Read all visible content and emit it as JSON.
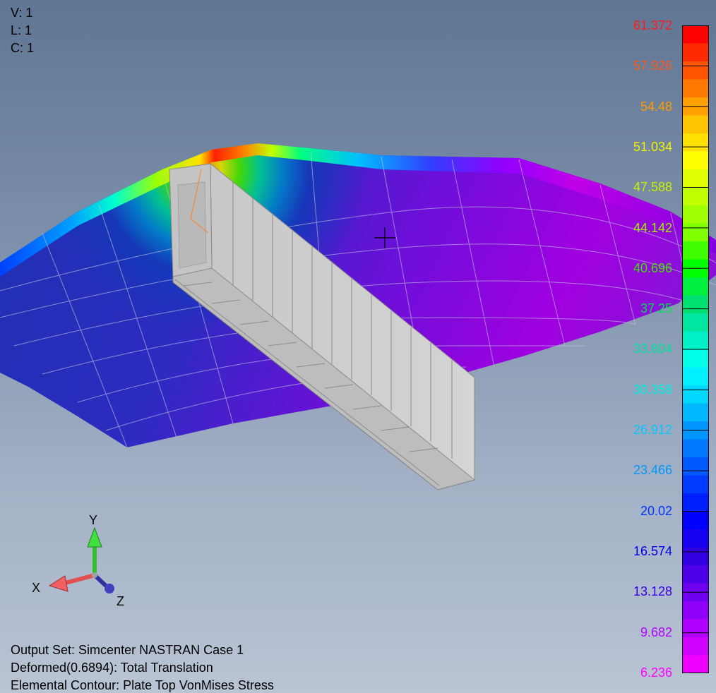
{
  "view_info": {
    "v": "V: 1",
    "l": "L: 1",
    "c": "C: 1"
  },
  "legend": {
    "labels": [
      "61.372",
      "57.926",
      "54.48",
      "51.034",
      "47.588",
      "44.142",
      "40.696",
      "37.25",
      "33.804",
      "30.358",
      "26.912",
      "23.466",
      "20.02",
      "16.574",
      "13.128",
      "9.682",
      "6.236"
    ],
    "label_colors": [
      "#ff1a1a",
      "#ff5a1a",
      "#ff9a00",
      "#f0f000",
      "#c8f000",
      "#a0f000",
      "#40e000",
      "#00e050",
      "#00e0a0",
      "#00f0e0",
      "#00c8ff",
      "#0096ff",
      "#0032ff",
      "#0000e0",
      "#3a00e0",
      "#b400ff",
      "#ff00ff"
    ],
    "bands": [
      "#ff0000",
      "#ff2a00",
      "#ff5500",
      "#ff7a00",
      "#ff9f00",
      "#ffc400",
      "#ffe000",
      "#ffff00",
      "#e0ff00",
      "#c0ff00",
      "#a0ff00",
      "#80ff00",
      "#40ff00",
      "#00ff00",
      "#00f040",
      "#00e070",
      "#00e6a0",
      "#00f0c8",
      "#00ffe6",
      "#00f0ff",
      "#00d8ff",
      "#00b8ff",
      "#0096ff",
      "#0078ff",
      "#005aff",
      "#003cff",
      "#0020ff",
      "#0000ff",
      "#1800f0",
      "#3000e0",
      "#5000e8",
      "#7000f0",
      "#9000f8",
      "#b000ff",
      "#d000ff",
      "#f000ff"
    ]
  },
  "axes": {
    "x": "X",
    "y": "Y",
    "z": "Z"
  },
  "output_info": {
    "line1": "Output Set: Simcenter NASTRAN Case 1",
    "line2": "Deformed(0.6894): Total Translation",
    "line3": "Elemental Contour: Plate Top VonMises Stress"
  }
}
